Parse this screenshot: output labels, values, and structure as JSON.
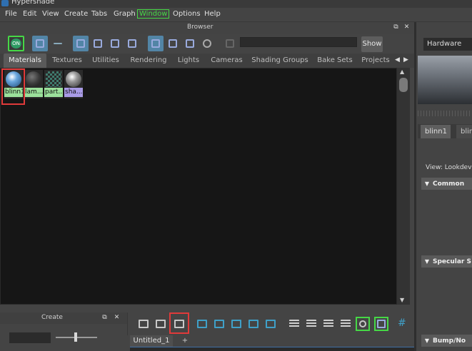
{
  "window": {
    "title": "Hypershade"
  },
  "menu": [
    "File",
    "Edit",
    "View",
    "Create",
    "Tabs",
    "Graph",
    "Window",
    "Options",
    "Help"
  ],
  "browser": {
    "panel_label": "Browser",
    "show_label": "Show",
    "tabs": [
      "Materials",
      "Textures",
      "Utilities",
      "Rendering",
      "Lights",
      "Cameras",
      "Shading Groups",
      "Bake Sets",
      "Projects"
    ],
    "swatches": [
      {
        "label": "blinn1",
        "color": "#9be09b"
      },
      {
        "label": "lam...",
        "color": "#9be09b"
      },
      {
        "label": "part...",
        "color": "#9be09b"
      },
      {
        "label": "sha...",
        "color": "#a99be6"
      }
    ]
  },
  "toolbar_toggle": {
    "label": "ON"
  },
  "create": {
    "panel_label": "Create"
  },
  "graph": {
    "tab_label": "Untitled_1",
    "add_tab": "+"
  },
  "right_panel": {
    "renderer": "Hardware",
    "tabs": [
      "blinn1",
      "blin"
    ],
    "view_label": "View: Lookdev",
    "sections": [
      "Common",
      "Specular S",
      "Bump/No"
    ]
  },
  "colors": {
    "highlight": "#46d846",
    "annotation": "#e03a3a",
    "selected_tool": "#5285a6"
  }
}
